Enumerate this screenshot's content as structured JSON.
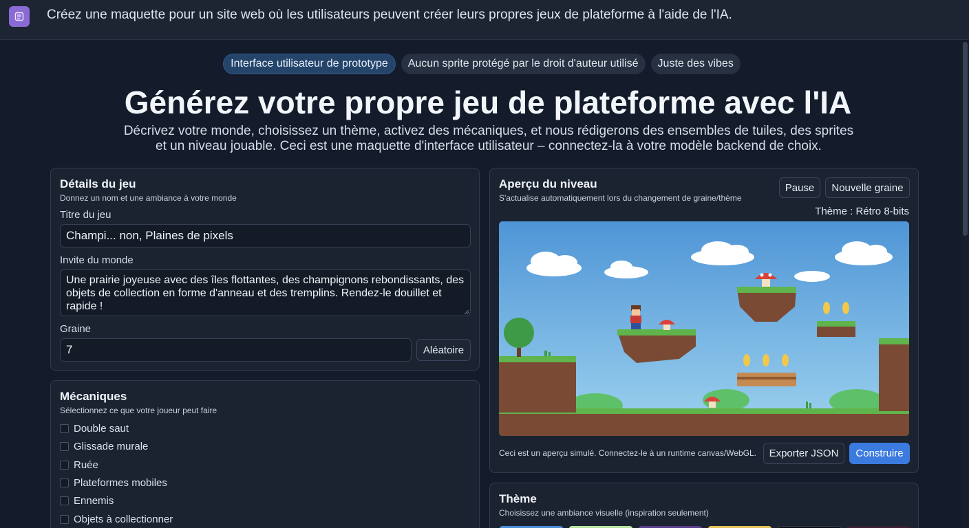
{
  "topbar": {
    "prompt": "Créez une maquette pour un site web où les utilisateurs peuvent créer leurs propres jeux de plateforme à l'aide de l'IA.",
    "icon": "document-icon"
  },
  "chips": [
    "Interface utilisateur de prototype",
    "Aucun sprite protégé par le droit d'auteur utilisé",
    "Juste des vibes"
  ],
  "hero": {
    "title": "Générez votre propre jeu de plateforme avec l'IA",
    "subtitle": "Décrivez votre monde, choisissez un thème, activez des mécaniques, et nous rédigerons des ensembles de tuiles, des sprites et un niveau jouable. Ceci est une maquette d'interface utilisateur – connectez-la à votre modèle backend de choix."
  },
  "details": {
    "title": "Détails du jeu",
    "subtitle": "Donnez un nom et une ambiance à votre monde",
    "game_title_label": "Titre du jeu",
    "game_title_value": "Champi... non, Plaines de pixels",
    "prompt_label": "Invite du monde",
    "prompt_value": "Une prairie joyeuse avec des îles flottantes, des champignons rebondissants, des objets de collection en forme d'anneau et des tremplins. Rendez-le douillet et rapide !",
    "seed_label": "Graine",
    "seed_value": "7",
    "random_button": "Aléatoire"
  },
  "mechanics": {
    "title": "Mécaniques",
    "subtitle": "Sélectionnez ce que votre joueur peut faire",
    "items": [
      "Double saut",
      "Glissade murale",
      "Ruée",
      "Plateformes mobiles",
      "Ennemis",
      "Objets à collectionner"
    ]
  },
  "preview": {
    "title": "Aperçu du niveau",
    "subtitle": "S'actualise automatiquement lors du changement de graine/thème",
    "pause_button": "Pause",
    "new_seed_button": "Nouvelle graine",
    "theme_label": "Thème : Rétro 8-bits",
    "footer_note": "Ceci est un aperçu simulé. Connectez-le à un runtime canvas/WebGL.",
    "export_button": "Exporter JSON",
    "build_button": "Construire"
  },
  "theme": {
    "title": "Thème",
    "subtitle": "Choisissez une ambiance visuelle (inspiration seulement)",
    "swatch_colors": [
      "#4a8fd8",
      "#b7e3a1",
      "#5b3e8f",
      "#e6c25a",
      "#0b0d12",
      "#3a1f33"
    ]
  },
  "colors": {
    "accent": "#3b7be0",
    "background": "#141c2b",
    "card": "#1b2331"
  }
}
